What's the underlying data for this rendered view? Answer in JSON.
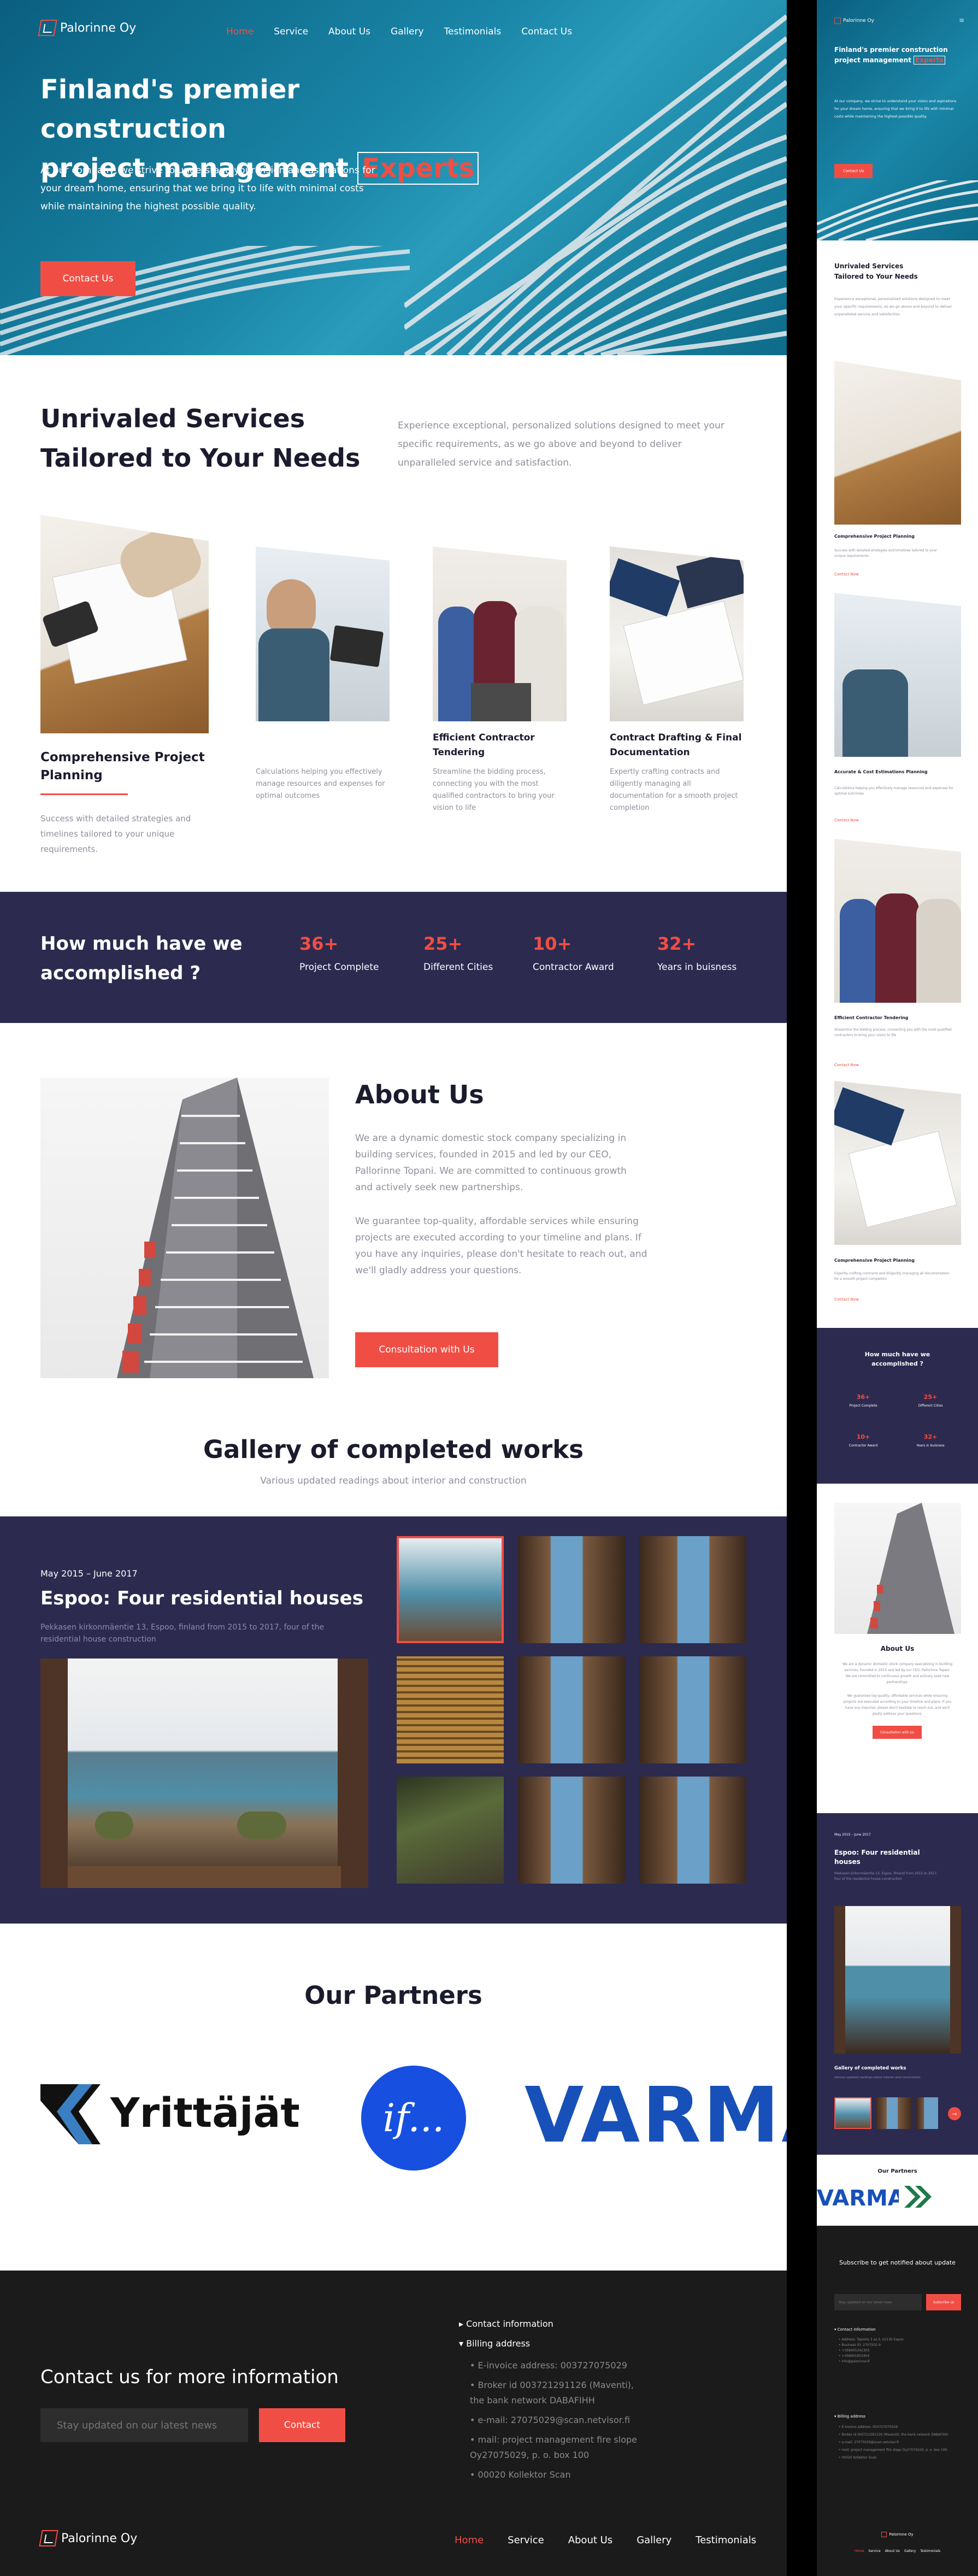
{
  "brand": {
    "name": "Palorinne Oy",
    "accent": "#f04e45",
    "navy": "#2c2a4f",
    "footer_bg": "#1b1b1b"
  },
  "nav": {
    "items": [
      "Home",
      "Service",
      "About Us",
      "Gallery",
      "Testimonials",
      "Contact Us"
    ],
    "active": "Home"
  },
  "hero": {
    "title_line1": "Finland's premier construction",
    "title_line2": "project management",
    "title_highlight": "Experts",
    "body": "At our company, we strive to understand your vision and aspirations for your dream home, ensuring that we bring it to life with minimal costs while maintaining the highest possible quality.",
    "cta": "Contact Us"
  },
  "services": {
    "title_line1": "Unrivaled Services",
    "title_line2": "Tailored to Your Needs",
    "intro": "Experience exceptional, personalized solutions designed to meet your specific requirements, as we go above and beyond to deliver unparalleled service and satisfaction.",
    "cards": [
      {
        "title": "Comprehensive Project Planning",
        "text": "Success with detailed strategies and timelines tailored to your unique requirements."
      },
      {
        "title": "",
        "text": "Calculations helping you effectively manage resources and expenses for optimal outcomes"
      },
      {
        "title": "Efficient Contractor Tendering",
        "text": "Streamline the bidding process, connecting you with the most qualified contractors to bring your vision to life"
      },
      {
        "title": "Contract Drafting & Final Documentation",
        "text": "Expertly crafting contracts and diligently managing all documentation for a smooth project completion"
      }
    ]
  },
  "stats": {
    "title": "How much have we accomplished ?",
    "items": [
      {
        "value": "36+",
        "label": "Project Complete"
      },
      {
        "value": "25+",
        "label": "Different Cities"
      },
      {
        "value": "10+",
        "label": "Contractor Award"
      },
      {
        "value": "32+",
        "label": "Years in buisness"
      }
    ]
  },
  "about": {
    "title": "About Us",
    "p1": "We are a dynamic domestic stock company specializing in building services, founded in 2015 and led by our CEO, Pallorinne Topani. We are committed to continuous growth and actively seek new partnerships.",
    "p2": "We guarantee top-quality, affordable services while ensuring projects are executed according to your timeline and plans. If you have any inquiries, please don't hesitate to reach out, and we'll gladly address your questions.",
    "cta": "Consultation with Us"
  },
  "gallery": {
    "title": "Gallery of completed works",
    "subtitle": "Various updated readings about interior and construction",
    "date": "May 2015 – June 2017",
    "project": "Espoo: Four residential houses",
    "desc": "Pekkasen kirkonmäentie 13, Espoo, finland from 2015 to 2017, four of the residential house construction"
  },
  "partners": {
    "title": "Our Partners",
    "logos": [
      "Yrittäjät",
      "if...",
      "VARMA"
    ]
  },
  "footer": {
    "contact_title": "Contact us for more information",
    "input_placeholder": "Stay updated on our latest news",
    "contact_btn": "Contact",
    "info_title": "Contact information",
    "billing_title": "Billing address",
    "billing": [
      "E-invoice address: 003727075029",
      "Broker id 003721291126 (Maventi), the bank network DABAFIHH",
      "e-mail: 27075029@scan.netvisor.fi",
      "mail: project management fire slope Oy27075029, p. o. box 100",
      "00020 Kollektor Scan"
    ]
  },
  "mobile": {
    "subscribe_title": "Subscribe to get notified about update",
    "subscribe_placeholder": "Stay updated on our latest news",
    "subscribe_btn": "Subscribe us",
    "contact_lines": [
      "Address: Tapiolie 3 as.3, 02130 Espoo",
      "Business ID: 2707502-9",
      "+358405342303",
      "+358401853404",
      "info@palorinne.fi"
    ],
    "card_link": "Contact Now",
    "m_cards": [
      "Comprehensive Project Planning",
      "Accurate & Cost Estimations Planning",
      "Efficient Contractor Tendering",
      "Comprehensive Project Planning"
    ]
  }
}
